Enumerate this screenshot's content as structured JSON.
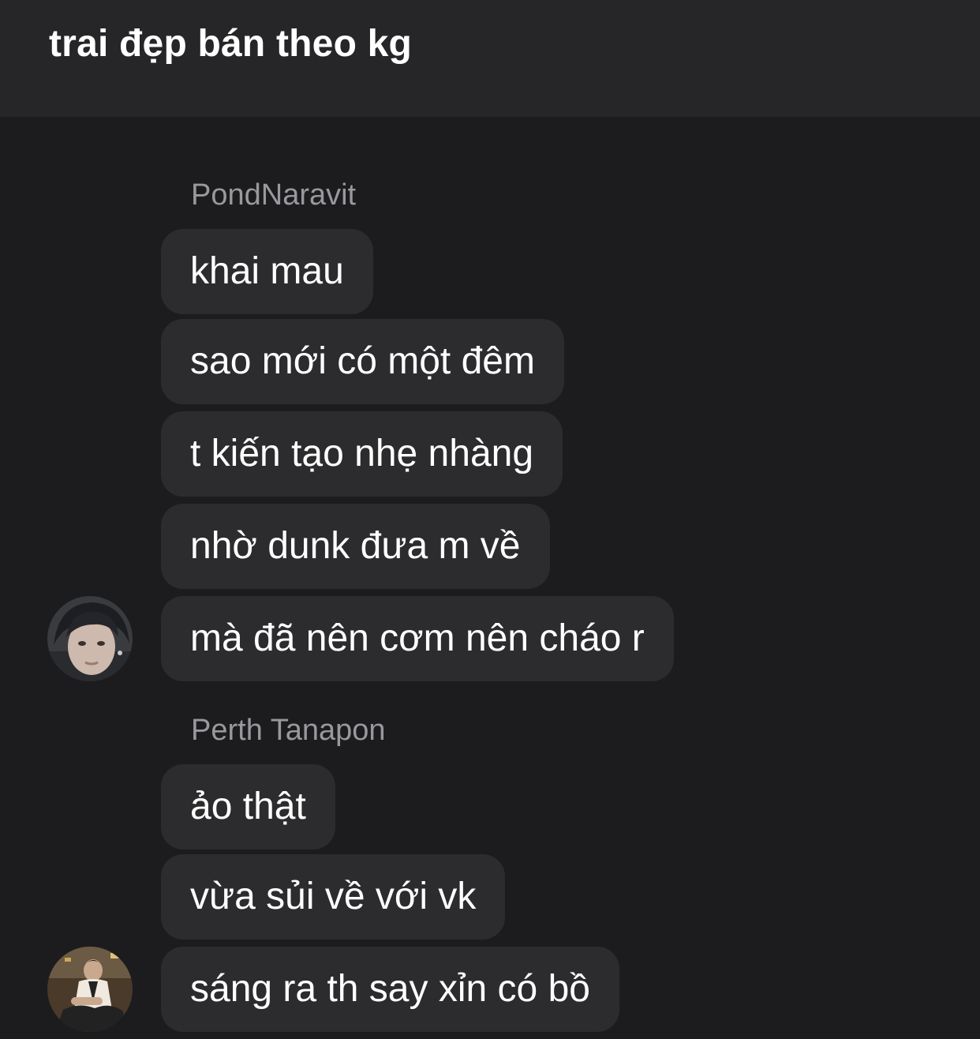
{
  "header": {
    "title": "trai đẹp bán theo kg"
  },
  "groups": [
    {
      "sender": "PondNaravit",
      "avatar_icon": "profile-photo-icon",
      "messages": [
        "khai mau",
        "sao mới có một đêm",
        "t kiến tạo nhẹ nhàng",
        "nhờ dunk đưa m về",
        "mà đã nên cơm nên cháo r"
      ]
    },
    {
      "sender": "Perth Tanapon",
      "avatar_icon": "profile-photo-icon",
      "messages": [
        "ảo thật",
        "vừa sủi về với vk",
        "sáng ra th say xỉn có bồ"
      ]
    }
  ],
  "colors": {
    "background": "#1c1c1e",
    "header_background": "#262628",
    "bubble": "#2c2c2e",
    "sender_name": "#98989d",
    "text": "#ffffff"
  }
}
